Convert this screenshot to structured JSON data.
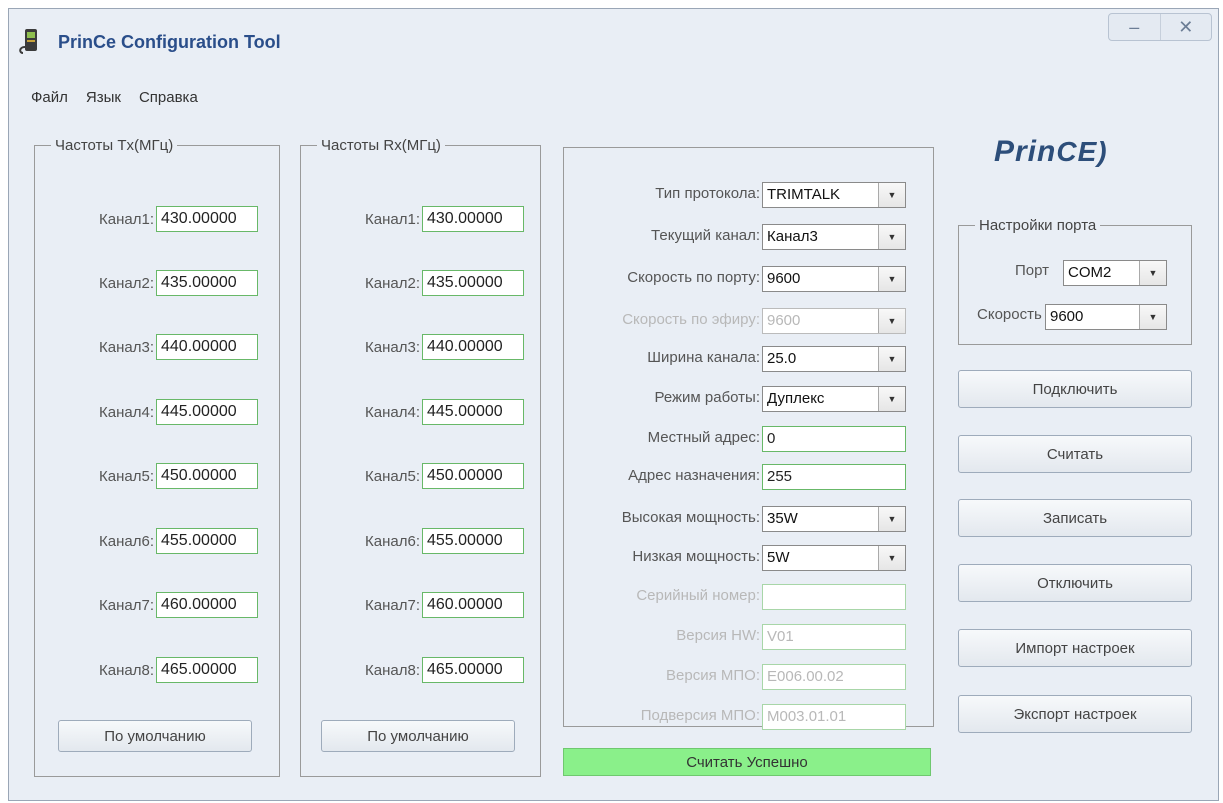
{
  "window": {
    "title": "PrinCe Configuration Tool",
    "minimize": "–",
    "close": "✕"
  },
  "menu": [
    "Файл",
    "Язык",
    "Справка"
  ],
  "tx": {
    "legend": "Частоты Tx(МГц)",
    "channels": [
      {
        "label": "Канал1:",
        "value": "430.00000"
      },
      {
        "label": "Канал2:",
        "value": "435.00000"
      },
      {
        "label": "Канал3:",
        "value": "440.00000"
      },
      {
        "label": "Канал4:",
        "value": "445.00000"
      },
      {
        "label": "Канал5:",
        "value": "450.00000"
      },
      {
        "label": "Канал6:",
        "value": "455.00000"
      },
      {
        "label": "Канал7:",
        "value": "460.00000"
      },
      {
        "label": "Канал8:",
        "value": "465.00000"
      }
    ],
    "default_button": "По умолчанию"
  },
  "rx": {
    "legend": "Частоты Rx(МГц)",
    "channels": [
      {
        "label": "Канал1:",
        "value": "430.00000"
      },
      {
        "label": "Канал2:",
        "value": "435.00000"
      },
      {
        "label": "Канал3:",
        "value": "440.00000"
      },
      {
        "label": "Канал4:",
        "value": "445.00000"
      },
      {
        "label": "Канал5:",
        "value": "450.00000"
      },
      {
        "label": "Канал6:",
        "value": "455.00000"
      },
      {
        "label": "Канал7:",
        "value": "460.00000"
      },
      {
        "label": "Канал8:",
        "value": "465.00000"
      }
    ],
    "default_button": "По умолчанию"
  },
  "params": {
    "protocol": {
      "label": "Тип протокола:",
      "value": "TRIMTALK"
    },
    "current_channel": {
      "label": "Текущий канал:",
      "value": "Канал3"
    },
    "port_speed": {
      "label": "Скорость по порту:",
      "value": "9600"
    },
    "air_speed": {
      "label": "Скорость по эфиру:",
      "value": "9600"
    },
    "channel_width": {
      "label": "Ширина канала:",
      "value": "25.0"
    },
    "mode": {
      "label": "Режим работы:",
      "value": "Дуплекс"
    },
    "local_address": {
      "label": "Местный адрес:",
      "value": "0"
    },
    "dest_address": {
      "label": "Адрес назначения:",
      "value": "255"
    },
    "high_power": {
      "label": "Высокая мощность:",
      "value": "35W"
    },
    "low_power": {
      "label": "Низкая мощность:",
      "value": "5W"
    },
    "serial": {
      "label": "Серийный номер:",
      "value": ""
    },
    "hw_version": {
      "label": "Версия HW:",
      "value": "V01"
    },
    "fw_version": {
      "label": "Версия МПО:",
      "value": "E006.00.02"
    },
    "fw_subversion": {
      "label": "Подверсия МПО:",
      "value": "M003.01.01"
    }
  },
  "status": "Считать Успешно",
  "logo": {
    "main": "Prin",
    "tail": "CE)"
  },
  "port_settings": {
    "legend": "Настройки порта",
    "port_label": "Порт",
    "port_value": "COM2",
    "speed_label": "Скорость",
    "speed_value": "9600"
  },
  "actions": {
    "connect": "Подключить",
    "read": "Считать",
    "write": "Записать",
    "disconnect": "Отключить",
    "import": "Импорт настроек",
    "export": "Экспорт настроек"
  },
  "colors": {
    "status_ok": "#8af08a",
    "title": "#2a4e8a",
    "field_border": "#68b868"
  }
}
